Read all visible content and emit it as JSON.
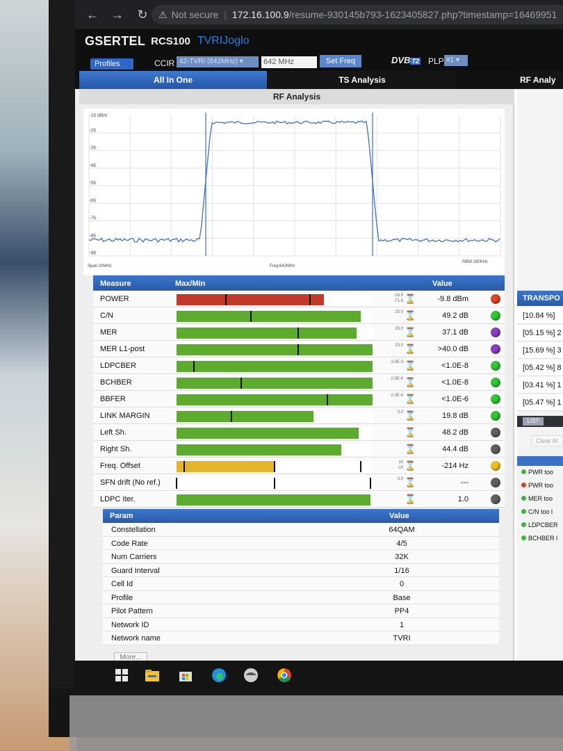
{
  "browser": {
    "back_icon": "back-arrow-icon",
    "url_prefix": "Not secure",
    "url_host": "172.16.100.9",
    "url_path": "/resume-930145b793-1623405827.php?timestamp=16469951"
  },
  "app": {
    "brand": "GSERTEL",
    "model": "RCS100",
    "station": "TVRIJoglo"
  },
  "controls": {
    "profiles_label": "Profiles",
    "ccir_label": "CCIR",
    "channel_value": "42-TVRI (642MHz)",
    "freq_value": "642 MHz",
    "setfreq_label": "Set Freq",
    "dvb_label": "DVB",
    "dvb_t2": "T2",
    "plp_label": "PLP",
    "plp_value": "#1"
  },
  "tabs": [
    "All In One",
    "TS Analysis",
    "RF Analy"
  ],
  "rf_title": "RF Analysis",
  "spectrum": {
    "top_label": "-16  dBm",
    "y_ticks": [
      "-26",
      "-36",
      "-46",
      "-56",
      "-66",
      "-76",
      "-86",
      "-96"
    ],
    "span": "Span:20MHz",
    "freq": "Freq:642MHz",
    "rbw": "RBW:180KHz",
    "noise_level": -87,
    "signal_level": -20
  },
  "measure": {
    "head_measure": "Measure",
    "head_maxmin": "Max/Min",
    "head_value": "Value",
    "rows": [
      {
        "name": "POWER",
        "fill": 0.75,
        "color": "#c0392b",
        "ticks": [
          0.25,
          0.68
        ],
        "limits": [
          "-16.9",
          "-71.9"
        ],
        "value": "-9.8 dBm",
        "led": "#e0462a"
      },
      {
        "name": "C/N",
        "fill": 0.94,
        "color": "#5cab2e",
        "ticks": [
          0.38
        ],
        "limits": [
          "20.0",
          ""
        ],
        "value": "49.2 dB",
        "led": "#33c733"
      },
      {
        "name": "MER",
        "fill": 0.92,
        "color": "#5cab2e",
        "ticks": [
          0.62
        ],
        "limits": [
          "23.0",
          ""
        ],
        "value": "37.1 dB",
        "led": "#8b3fc2"
      },
      {
        "name": "MER L1-post",
        "fill": 1.0,
        "color": "#5cab2e",
        "ticks": [
          0.62
        ],
        "limits": [
          "23.0",
          ""
        ],
        "value": ">40.0 dB",
        "led": "#8b3fc2"
      },
      {
        "name": "LDPCBER",
        "fill": 1.0,
        "color": "#5cab2e",
        "ticks": [
          0.09
        ],
        "limits": [
          "3.0E-3",
          ""
        ],
        "value": "<1.0E-8",
        "led": "#33c733"
      },
      {
        "name": "BCHBER",
        "fill": 1.0,
        "color": "#5cab2e",
        "ticks": [
          0.33
        ],
        "limits": [
          "2.0E-4",
          ""
        ],
        "value": "<1.0E-8",
        "led": "#33c733"
      },
      {
        "name": "BBFER",
        "fill": 1.0,
        "color": "#5cab2e",
        "ticks": [
          0.77
        ],
        "limits": [
          "2.0E-4",
          ""
        ],
        "value": "<1.0E-6",
        "led": "#33c733"
      },
      {
        "name": "LINK MARGIN",
        "fill": 0.7,
        "color": "#5cab2e",
        "ticks": [
          0.28
        ],
        "limits": [
          "3.0",
          ""
        ],
        "value": "19.8 dB",
        "led": "#33c733"
      },
      {
        "name": "Left Sh.",
        "fill": 0.93,
        "color": "#5cab2e",
        "ticks": [],
        "limits": [
          "",
          ""
        ],
        "value": "48.2 dB",
        "led": "#606060"
      },
      {
        "name": "Right Sh.",
        "fill": 0.84,
        "color": "#5cab2e",
        "ticks": [],
        "limits": [
          "",
          ""
        ],
        "value": "44.4 dB",
        "led": "#606060"
      },
      {
        "name": "Freq. Offset",
        "fill": 0.5,
        "color": "#e2b52c",
        "ticks": [
          0.04,
          0.5,
          0.94
        ],
        "limits": [
          "10",
          "-10"
        ],
        "value": "-214 Hz",
        "led": "#f0c020"
      },
      {
        "name": "SFN drift (No ref.)",
        "fill": 0.0,
        "color": "#5cab2e",
        "ticks": [
          0.0,
          0.5,
          0.99
        ],
        "limits": [
          "3.0",
          ""
        ],
        "value": "---",
        "led": "#606060"
      },
      {
        "name": "LDPC Iter.",
        "fill": 0.99,
        "color": "#5cab2e",
        "ticks": [],
        "limits": [
          "",
          ""
        ],
        "value": "1.0",
        "led": "#606060"
      }
    ]
  },
  "params": {
    "head_param": "Param",
    "head_value": "Value",
    "rows": [
      {
        "name": "Constellation",
        "value": "64QAM"
      },
      {
        "name": "Code Rate",
        "value": "4/5"
      },
      {
        "name": "Num Carriers",
        "value": "32K"
      },
      {
        "name": "Guard Interval",
        "value": "1/16"
      },
      {
        "name": "Cell Id",
        "value": "0"
      },
      {
        "name": "Profile",
        "value": "Base"
      },
      {
        "name": "Pilot Pattern",
        "value": "PP4"
      },
      {
        "name": "Network ID",
        "value": "1"
      },
      {
        "name": "Network name",
        "value": "TVRI"
      }
    ],
    "more_label": "More..."
  },
  "right_panel": {
    "transport_head": "TRANSPO",
    "transport_rows": [
      "[10.84 %] ",
      "[05.15 %] 2",
      "[15.69 %] 3",
      "[05.42 %] 8",
      "[03.41 %] 1",
      "[05.47 %] 1"
    ],
    "list_tab": "LIST",
    "clear_label": "Clear Al",
    "alarms": [
      {
        "text": "PWR too",
        "color": "#3fb43f"
      },
      {
        "text": "PWR too",
        "color": "#d0452a"
      },
      {
        "text": "MER too",
        "color": "#3fb43f"
      },
      {
        "text": "C/N too l",
        "color": "#3fb43f"
      },
      {
        "text": "LDPCBER",
        "color": "#3fb43f"
      },
      {
        "text": "BCHBER l",
        "color": "#3fb43f"
      }
    ]
  },
  "taskbar": {
    "icons": [
      "windows-start-icon",
      "file-explorer-icon",
      "store-icon",
      "edge-icon",
      "app-icon",
      "chrome-icon"
    ]
  }
}
